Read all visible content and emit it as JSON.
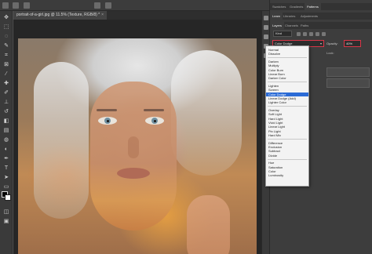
{
  "document": {
    "tab_title": "portrait-of-a-girl.jpg @ 11.5% (Texture, RGB/8) *",
    "close_glyph": "×"
  },
  "panels": {
    "top_tabs": [
      "Swatches",
      "Gradients",
      "Patterns"
    ],
    "mid_tabs": [
      "Learn",
      "Libraries",
      "Adjustments"
    ],
    "layer_tabs": [
      "Layers",
      "Channels",
      "Paths"
    ],
    "kind_filter": "Kind",
    "blend_mode": "Color Dodge",
    "opacity_label": "Opacity:",
    "opacity_value": "40%",
    "lock_label": "Lock:"
  },
  "blend_menu": {
    "groups": [
      [
        "Normal",
        "Dissolve"
      ],
      [
        "Darken",
        "Multiply",
        "Color Burn",
        "Linear Burn",
        "Darker Color"
      ],
      [
        "Lighten",
        "Screen",
        "Color Dodge",
        "Linear Dodge (Add)",
        "Lighter Color"
      ],
      [
        "Overlay",
        "Soft Light",
        "Hard Light",
        "Vivid Light",
        "Linear Light",
        "Pin Light",
        "Hard Mix"
      ],
      [
        "Difference",
        "Exclusion",
        "Subtract",
        "Divide"
      ],
      [
        "Hue",
        "Saturation",
        "Color",
        "Luminosity"
      ]
    ],
    "selected": "Color Dodge"
  },
  "colors": {
    "accent_red": "#d93648",
    "selection_blue": "#2b6bd6"
  }
}
